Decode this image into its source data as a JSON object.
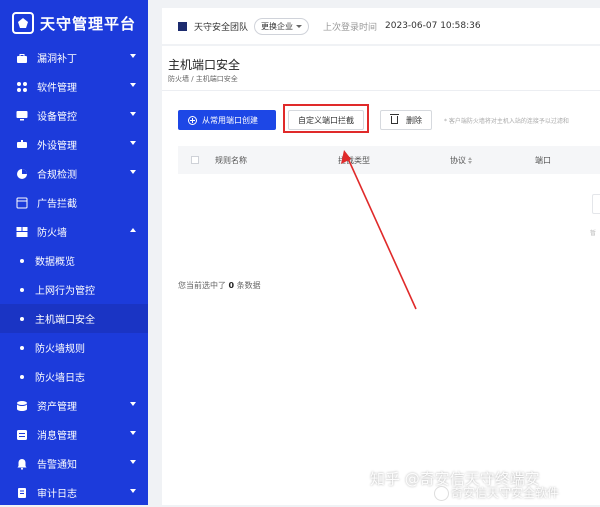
{
  "app": {
    "title": "天守管理平台"
  },
  "sidebar": {
    "items": [
      {
        "label": "漏洞补丁",
        "icon": "bag-icon",
        "chevron": "down"
      },
      {
        "label": "软件管理",
        "icon": "apps-icon",
        "chevron": "down"
      },
      {
        "label": "设备管控",
        "icon": "monitor-icon",
        "chevron": "down"
      },
      {
        "label": "外设管理",
        "icon": "peripheral-icon",
        "chevron": "down"
      },
      {
        "label": "合规检测",
        "icon": "compliance-icon",
        "chevron": "down"
      },
      {
        "label": "广告拦截",
        "icon": "ad-block-icon",
        "chevron": ""
      },
      {
        "label": "防火墙",
        "icon": "firewall-icon",
        "chevron": "up"
      },
      {
        "label": "数据概览",
        "sub": true
      },
      {
        "label": "上网行为管控",
        "sub": true
      },
      {
        "label": "主机端口安全",
        "sub": true,
        "active": true
      },
      {
        "label": "防火墙规则",
        "sub": true
      },
      {
        "label": "防火墙日志",
        "sub": true
      },
      {
        "label": "资产管理",
        "icon": "asset-icon",
        "chevron": "down"
      },
      {
        "label": "消息管理",
        "icon": "message-icon",
        "chevron": "down"
      },
      {
        "label": "告警通知",
        "icon": "bell-icon",
        "chevron": "down"
      },
      {
        "label": "审计日志",
        "icon": "audit-icon",
        "chevron": "down"
      }
    ]
  },
  "header": {
    "org_name": "天守安全团队",
    "switch_label": "更换企业",
    "last_login_label": "上次登录时间",
    "last_login_time": "2023-06-07 10:58:36"
  },
  "main": {
    "title": "主机端口安全",
    "breadcrumb": "防火墙 / 主机端口安全",
    "actions": {
      "create_from_common": "从常用端口创建",
      "custom_block": "自定义端口拦截",
      "delete": "删除"
    },
    "hint": "* 客户端防火墙将对主机入站的连接予以过滤和",
    "table": {
      "columns": [
        "规则名称",
        "拦截类型",
        "协议",
        "端口"
      ],
      "rows": []
    },
    "empty_text": "暂",
    "selection": {
      "prefix": "您当前选中了",
      "count": "0",
      "suffix": "条数据"
    }
  },
  "watermark": {
    "line1": "知乎 @奇安信天守终端安",
    "line2": "奇安信天守安全软件"
  },
  "colors": {
    "sidebar_bg": "#1c3bdb",
    "primary": "#1d47e6",
    "highlight": "#e02a2a"
  }
}
